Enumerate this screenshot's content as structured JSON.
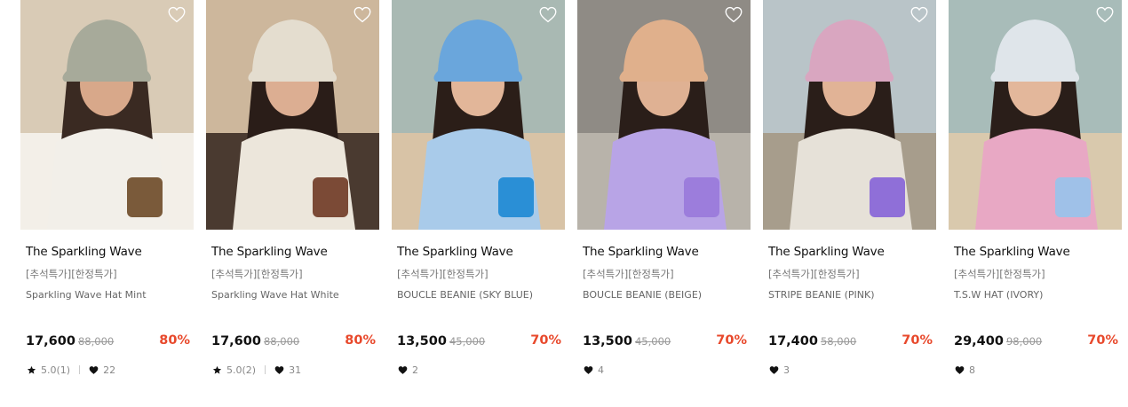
{
  "products": [
    {
      "brand": "The Sparkling Wave",
      "tags": "[추석특가][한정특가]",
      "name": "Sparkling Wave Hat Mint",
      "price": "17,600",
      "original_price": "88,000",
      "discount": "80%",
      "rating": "5.0(1)",
      "likes": "22",
      "colors": {
        "bg": "#d9cbb6",
        "bg2": "#f3efe8",
        "hat": "#a7aa9a",
        "shirt": "#f2efe9",
        "hair": "#3a2a22",
        "skin": "#d8a88a",
        "accent": "#7a5a3a"
      }
    },
    {
      "brand": "The Sparkling Wave",
      "tags": "[추석특가][한정특가]",
      "name": "Sparkling Wave Hat White",
      "price": "17,600",
      "original_price": "88,000",
      "discount": "80%",
      "rating": "5.0(2)",
      "likes": "31",
      "colors": {
        "bg": "#cdb79c",
        "bg2": "#4a3a30",
        "hat": "#e4ddcf",
        "shirt": "#ece6db",
        "hair": "#2a1d18",
        "skin": "#dcae92",
        "accent": "#7b4a36"
      }
    },
    {
      "brand": "The Sparkling Wave",
      "tags": "[추석특가][한정특가]",
      "name": "BOUCLE BEANIE (SKY BLUE)",
      "price": "13,500",
      "original_price": "45,000",
      "discount": "70%",
      "rating": "",
      "likes": "2",
      "colors": {
        "bg": "#a9b9b3",
        "bg2": "#d8c3a6",
        "hat": "#6aa6dc",
        "shirt": "#a9cbea",
        "hair": "#2b1e18",
        "skin": "#e2b699",
        "accent": "#2a8fd6"
      }
    },
    {
      "brand": "The Sparkling Wave",
      "tags": "[추석특가][한정특가]",
      "name": "BOUCLE BEANIE (BEIGE)",
      "price": "13,500",
      "original_price": "45,000",
      "discount": "70%",
      "rating": "",
      "likes": "4",
      "colors": {
        "bg": "#8f8b85",
        "bg2": "#b8b3aa",
        "hat": "#e0b08c",
        "shirt": "#b8a4e6",
        "hair": "#2a1e19",
        "skin": "#dfb193",
        "accent": "#9c7ddc"
      }
    },
    {
      "brand": "The Sparkling Wave",
      "tags": "[추석특가][한정특가]",
      "name": "STRIPE BEANIE (PINK)",
      "price": "17,400",
      "original_price": "58,000",
      "discount": "70%",
      "rating": "",
      "likes": "3",
      "colors": {
        "bg": "#b9c4c8",
        "bg2": "#a79d8c",
        "hat": "#d9a6c0",
        "shirt": "#e6e1d8",
        "hair": "#2a1e19",
        "skin": "#e1b396",
        "accent": "#8f6fd8"
      }
    },
    {
      "brand": "The Sparkling Wave",
      "tags": "[추석특가][한정특가]",
      "name": "T.S.W HAT (IVORY)",
      "price": "29,400",
      "original_price": "98,000",
      "discount": "70%",
      "rating": "",
      "likes": "8",
      "colors": {
        "bg": "#a8bcb9",
        "bg2": "#d9c9ad",
        "hat": "#dfe5ea",
        "shirt": "#e8a8c4",
        "hair": "#2a1e19",
        "skin": "#e3b79b",
        "accent": "#9fc1e8"
      }
    }
  ],
  "icons": {
    "wishlist": "heart-outline-icon",
    "rating": "star-icon",
    "likes": "heart-icon"
  },
  "theme": {
    "discount_color": "#e8492c",
    "text_dark": "#111111",
    "text_muted": "#777777"
  }
}
